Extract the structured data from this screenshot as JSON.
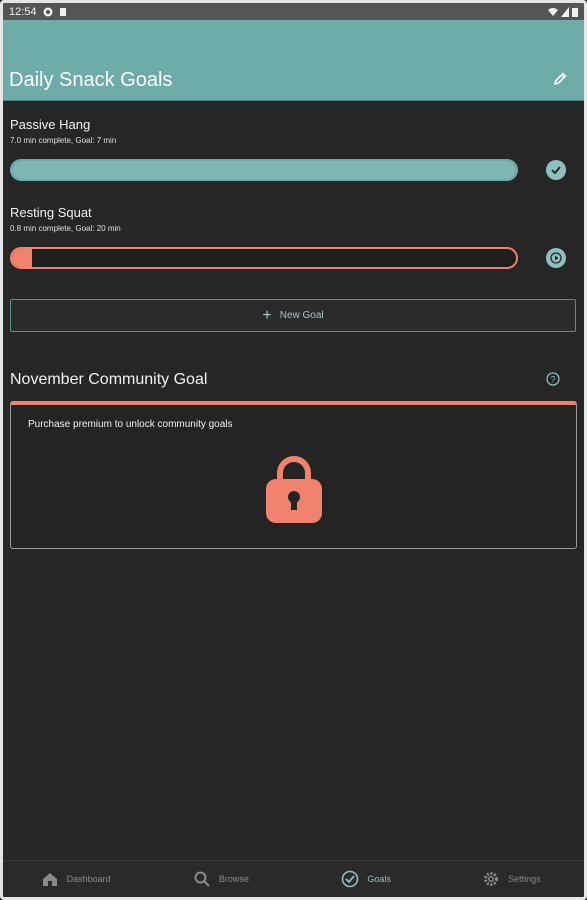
{
  "status_bar": {
    "time": "12:54"
  },
  "app_bar": {
    "title": "Daily Snack Goals"
  },
  "goals": [
    {
      "title": "Passive Hang",
      "subtitle": "7.0 min complete, Goal: 7 min",
      "progress": 1.0,
      "status": "complete"
    },
    {
      "title": "Resting Squat",
      "subtitle": "0.8 min complete, Goal: 20 min",
      "progress": 0.04,
      "status": "play"
    }
  ],
  "new_goal": {
    "label": "New Goal"
  },
  "community": {
    "title": "November Community Goal",
    "locked_message": "Purchase premium to unlock community goals"
  },
  "nav": {
    "items": [
      {
        "label": "Dashboard",
        "icon": "home-icon"
      },
      {
        "label": "Browse",
        "icon": "search-icon"
      },
      {
        "label": "Goals",
        "icon": "check-circle-icon"
      },
      {
        "label": "Settings",
        "icon": "gear-icon"
      }
    ],
    "active": "Goals"
  },
  "colors": {
    "accent": "#6eaca8",
    "warning": "#f0826e",
    "background": "#262626"
  }
}
